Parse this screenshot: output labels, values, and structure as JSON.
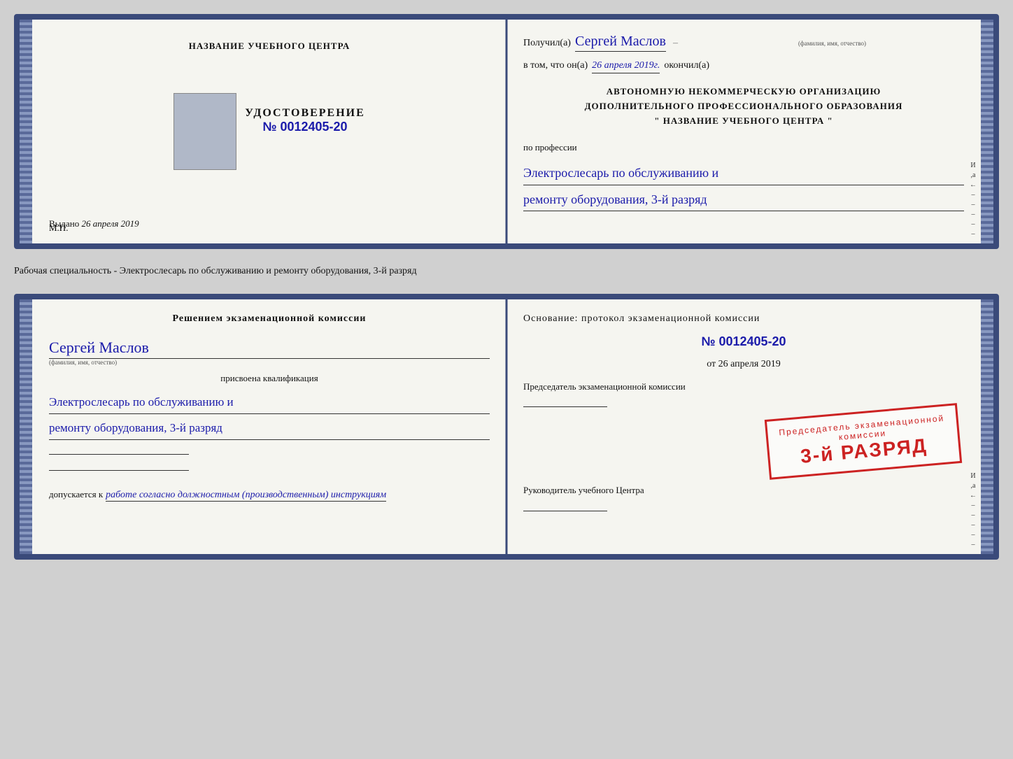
{
  "top_doc": {
    "left": {
      "center_title": "НАЗВАНИЕ УЧЕБНОГО ЦЕНТРА",
      "udostoverenie_label": "УДОСТОВЕРЕНИЕ",
      "udostoverenie_number": "№ 0012405-20",
      "vydano_label": "Выдано",
      "vydano_date": "26 апреля 2019",
      "mp_label": "М.П."
    },
    "right": {
      "poluchil_label": "Получил(а)",
      "recipient_name": "Сергей Маслов",
      "fio_small": "(фамилия, имя, отчество)",
      "vtom_label": "в том, что он(а)",
      "vtom_date": "26 апреля 2019г.",
      "okonchil_label": "окончил(а)",
      "org_line1": "АВТОНОМНУЮ НЕКОММЕРЧЕСКУЮ ОРГАНИЗАЦИЮ",
      "org_line2": "ДОПОЛНИТЕЛЬНОГО ПРОФЕССИОНАЛЬНОГО ОБРАЗОВАНИЯ",
      "org_line3": "\"   НАЗВАНИЕ УЧЕБНОГО ЦЕНТРА   \"",
      "po_professii_label": "по профессии",
      "profession_line1": "Электрослесарь по обслуживанию и",
      "profession_line2": "ремонту оборудования, 3-й разряд"
    }
  },
  "separator": {
    "text": "Рабочая специальность - Электрослесарь по обслуживанию и ремонту оборудования, 3-й разряд"
  },
  "bottom_doc": {
    "left": {
      "resheniem_label": "Решением экзаменационной комиссии",
      "recipient_name": "Сергей Маслов",
      "fio_small": "(фамилия, имя, отчество)",
      "prisvoena_label": "присвоена квалификация",
      "profession_line1": "Электрослесарь по обслуживанию и",
      "profession_line2": "ремонту оборудования, 3-й разряд",
      "dopuskaetsya_label": "допускается к",
      "dopuskaetsya_work": "работе согласно должностным (производственным) инструкциям"
    },
    "right": {
      "osnovanje_label": "Основание: протокол экзаменационной комиссии",
      "protocol_number": "№ 0012405-20",
      "ot_label": "от",
      "ot_date": "26 апреля 2019",
      "predsedatel_label": "Председатель экзаменационной комиссии",
      "rukovoditel_label": "Руководитель учебного Центра"
    },
    "stamp": {
      "top_text": "Председатель экзаменационной\nкомиссии",
      "main_text": "3-й РАЗРЯД"
    }
  },
  "deco": {
    "letters_right": [
      "И",
      "а",
      "←",
      "–",
      "–",
      "–",
      "–",
      "–"
    ]
  }
}
